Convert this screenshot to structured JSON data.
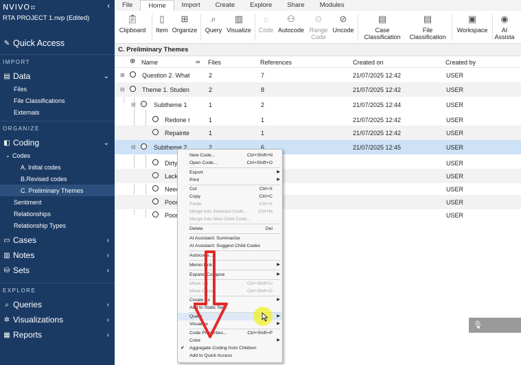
{
  "app": {
    "logo": "NVIVO⠶",
    "project": "RTA PROJECT 1.nvp (Edited)"
  },
  "sidebar": {
    "quick_access": "Quick Access",
    "import_label": "IMPORT",
    "data_label": "Data",
    "data_items": [
      "Files",
      "File Classifications",
      "Externals"
    ],
    "organize_label": "ORGANIZE",
    "coding_label": "Coding",
    "codes_label": "Codes",
    "codes_items": [
      "A. Initial codes",
      "B.Revised codes",
      "C. Preliminary Themes"
    ],
    "coding_items": [
      "Sentiment",
      "Relationships",
      "Relationship Types"
    ],
    "cases_label": "Cases",
    "notes_label": "Notes",
    "sets_label": "Sets",
    "explore_label": "EXPLORE",
    "queries_label": "Queries",
    "visualizations_label": "Visualizations",
    "reports_label": "Reports"
  },
  "tabs": [
    "File",
    "Home",
    "Import",
    "Create",
    "Explore",
    "Share",
    "Modules"
  ],
  "ribbon": {
    "clipboard": "Clipboard",
    "item": "Item",
    "organize": "Organize",
    "query": "Query",
    "visualize": "Visualize",
    "code": "Code",
    "autocode": "Autocode",
    "range_code_1": "Range",
    "range_code_2": "Code",
    "uncode": "Uncode",
    "case_class_1": "Case",
    "case_class_2": "Classification",
    "file_class_1": "File",
    "file_class_2": "Classification",
    "workspace": "Workspace",
    "ai_1": "AI",
    "ai_2": "Assista"
  },
  "area_title": "C. Preliminary Themes",
  "columns": {
    "name": "Name",
    "files": "Files",
    "references": "References",
    "created_on": "Created on",
    "created_by": "Created by"
  },
  "rows": [
    {
      "name": "Question 2. What",
      "files": "2",
      "refs": "7",
      "date": "21/07/2025 12:42",
      "by": "USER"
    },
    {
      "name": "Theme 1. Studen",
      "files": "2",
      "refs": "8",
      "date": "21/07/2025 12:42",
      "by": "USER"
    },
    {
      "name": "Subtheme 1",
      "files": "1",
      "refs": "2",
      "date": "21/07/2025 12:44",
      "by": "USER"
    },
    {
      "name": "Redone r",
      "files": "1",
      "refs": "1",
      "date": "21/07/2025 12:42",
      "by": "USER"
    },
    {
      "name": "Repainte",
      "files": "1",
      "refs": "1",
      "date": "21/07/2025 12:42",
      "by": "USER"
    },
    {
      "name": "Subtheme 2",
      "files": "2",
      "refs": "6",
      "date": "21/07/2025 12:45",
      "by": "USER"
    },
    {
      "name": "Dirty",
      "files": "",
      "refs": "",
      "date": "",
      "by": "USER"
    },
    {
      "name": "Lack",
      "files": "",
      "refs": "",
      "date": "",
      "by": "USER"
    },
    {
      "name": "Neec",
      "files": "",
      "refs": "",
      "date": "",
      "by": "USER"
    },
    {
      "name": "Poor",
      "files": "",
      "refs": "",
      "date": "",
      "by": "USER"
    },
    {
      "name": "Poor",
      "files": "",
      "refs": "",
      "date": "",
      "by": "USER"
    }
  ],
  "menu": {
    "new_code": "New Code...",
    "new_code_sc": "Ctrl+Shift+N",
    "open_code": "Open Code...",
    "open_code_sc": "Ctrl+Shift+O",
    "export": "Export",
    "print": "Print",
    "cut": "Cut",
    "cut_sc": "Ctrl+X",
    "copy": "Copy",
    "copy_sc": "Ctrl+C",
    "paste": "Paste",
    "paste_sc": "Ctrl+V",
    "merge_selected": "Merge Into Selected Code...",
    "merge_selected_sc": "Ctrl+M",
    "merge_new": "Merge Into New Child Code...",
    "delete": "Delete",
    "delete_sc": "Del",
    "ai_summarize": "AI Assistant: Summarize",
    "ai_suggest": "AI Assistant: Suggest Child Codes",
    "autocode": "Autocode...",
    "memo_link": "Memo Link",
    "expand": "Expand/Collapse",
    "move_up": "Move Up",
    "move_up_sc": "Ctrl+Shift+U",
    "move_down": "Move Down",
    "move_down_sc": "Ctrl+Shift+D",
    "create_as": "Create As",
    "add_set": "Add to Static Set...",
    "query": "Query",
    "visualize": "Visualize",
    "code_props": "Code Properties...",
    "code_props_sc": "Ctrl+Shift+P",
    "color": "Color",
    "aggregate": "Aggregate Coding from Children",
    "quick_access": "Add to Quick Access"
  },
  "colors": {
    "sidebar": "#1b3a63",
    "selected_row": "#cde2f7",
    "arrow": "#e02a2a",
    "cursor_highlight": "#f0f028"
  },
  "icons": [
    "clipboard-icon",
    "item-icon",
    "organize-icon",
    "query-icon",
    "visualize-icon",
    "code-icon",
    "autocode-icon",
    "range-code-icon",
    "uncode-icon",
    "case-classification-icon",
    "file-classification-icon",
    "workspace-icon",
    "ai-assistant-icon",
    "pin-icon",
    "microphone-icon"
  ]
}
